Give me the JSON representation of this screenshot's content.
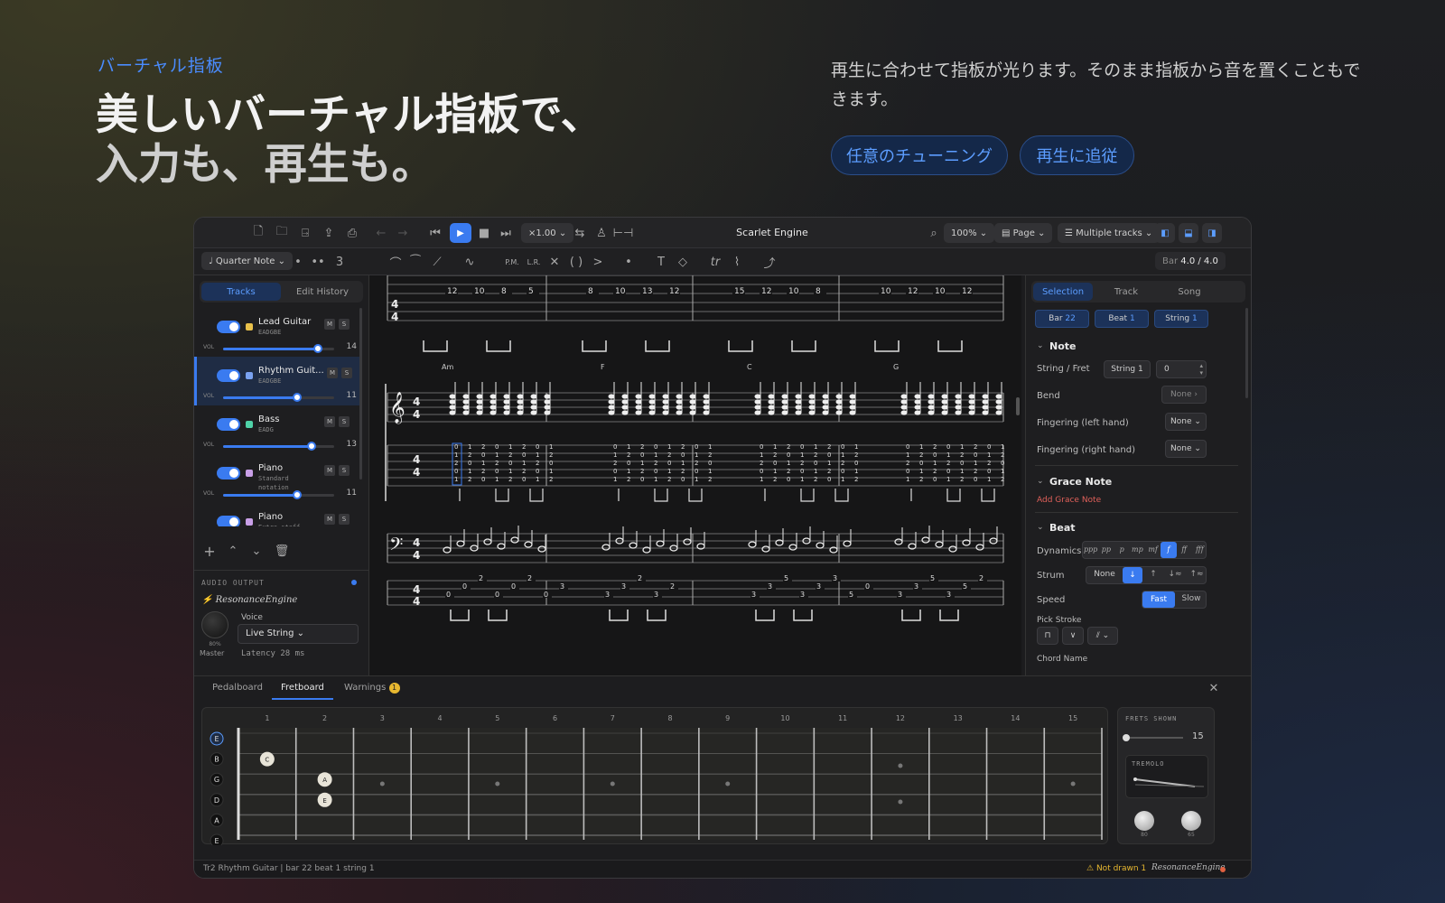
{
  "hero": {
    "eyebrow": "バーチャル指板",
    "title_line1": "美しいバーチャル指板で、",
    "title_line2": "入力も、再生も。",
    "description": "再生に合わせて指板が光ります。そのまま指板から音を置くこともできます。",
    "pill1": "任意のチューニング",
    "pill2": "再生に追従"
  },
  "toolbar": {
    "speed": "×1.00",
    "title": "Scarlet Engine",
    "zoom": "100%",
    "view": "Page",
    "tracks_mode": "Multiple tracks"
  },
  "toolbar2": {
    "note_value": "Quarter Note",
    "tuplet": "3",
    "pm": "P.M.",
    "lr": "L.R.",
    "bar_label": "Bar",
    "bar_value": "4.0 / 4.0"
  },
  "left": {
    "tab_tracks": "Tracks",
    "tab_history": "Edit History",
    "tracks": [
      {
        "name": "Lead Guitar",
        "sub": "EADGBE",
        "vol": 14,
        "level": 0.85,
        "color": "#e8c04a"
      },
      {
        "name": "Rhythm Guit...",
        "sub": "EADGBE",
        "vol": 11,
        "level": 0.67,
        "color": "#7aa2f0"
      },
      {
        "name": "Bass",
        "sub": "EADG",
        "vol": 13,
        "level": 0.8,
        "color": "#4fd2a8"
      },
      {
        "name": "Piano",
        "sub": "Standard notation",
        "vol": 11,
        "level": 0.67,
        "color": "#c9a0e8"
      },
      {
        "name": "Piano",
        "sub": "Extra staff",
        "vol": null,
        "level": null,
        "color": "#c9a0e8"
      }
    ],
    "m": "M",
    "s": "S",
    "vol_label": "VOL",
    "audio_output": "AUDIO OUTPUT",
    "engine": "ResonanceEngine",
    "voice_label": "Voice",
    "voice_value": "Live String",
    "latency": "Latency 28 ms",
    "master_label": "Master",
    "master_pct": "80%"
  },
  "score": {
    "chords": [
      "Am",
      "F",
      "C",
      "G"
    ],
    "tab_top": [
      [
        "12",
        "10",
        "8",
        "5"
      ],
      [
        "8",
        "10",
        "13",
        "12"
      ],
      [
        "15",
        "12",
        "10",
        "8"
      ],
      [
        "10",
        "12",
        "10",
        "12"
      ]
    ],
    "bass_tab": [
      [
        "0",
        "0",
        "2",
        "0",
        "0",
        "2",
        "0",
        "3"
      ],
      [
        "3",
        "3",
        "2",
        "3",
        "2"
      ],
      [
        "3",
        "3",
        "5",
        "3",
        "3",
        "3",
        "5",
        "0"
      ],
      [
        "3",
        "3",
        "5",
        "3",
        "5",
        "2"
      ]
    ]
  },
  "right": {
    "tabs": [
      "Selection",
      "Track",
      "Song"
    ],
    "bar": "Bar",
    "bar_v": "22",
    "beat": "Beat",
    "beat_v": "1",
    "string": "String",
    "string_v": "1",
    "note_head": "Note",
    "string_fret": "String / Fret",
    "sf_string": "String 1",
    "sf_fret": "0",
    "bend": "Bend",
    "bend_v": "None",
    "fing_l": "Fingering (left hand)",
    "fing_l_v": "None",
    "fing_r": "Fingering (right hand)",
    "fing_r_v": "None",
    "grace_head": "Grace Note",
    "add_grace": "Add Grace Note",
    "beat_head": "Beat",
    "dynamics": "Dynamics",
    "dyn_opts": [
      "ppp",
      "pp",
      "p",
      "mp",
      "mf",
      "f",
      "ff",
      "fff"
    ],
    "dyn_sel": "f",
    "strum": "Strum",
    "strum_none": "None",
    "strum_opts": [
      "↓",
      "↑",
      "↓≈",
      "↑≈"
    ],
    "speed": "Speed",
    "fast": "Fast",
    "slow": "Slow",
    "pick_stroke": "Pick Stroke",
    "chord_name": "Chord Name"
  },
  "bottom": {
    "tabs": [
      "Pedalboard",
      "Fretboard",
      "Warnings"
    ],
    "warn_count": "1",
    "frets": [
      "1",
      "2",
      "3",
      "4",
      "5",
      "6",
      "7",
      "8",
      "9",
      "10",
      "11",
      "12",
      "13",
      "14",
      "15"
    ],
    "strings": [
      "E",
      "B",
      "G",
      "D",
      "A",
      "E"
    ],
    "dots": [
      {
        "string": 1,
        "fret": 1,
        "label": "C"
      },
      {
        "string": 2,
        "fret": 2,
        "label": "A"
      },
      {
        "string": 3,
        "fret": 2,
        "label": "E"
      }
    ],
    "frets_shown": "FRETS SHOWN",
    "frets_shown_v": "15",
    "tremolo": "TREMOLO",
    "knob1": "80",
    "knob2": "65"
  },
  "status": {
    "left": "Tr2 Rhythm Guitar | bar 22 beat 1 string 1",
    "warn": "Not drawn 1",
    "engine": "ResonanceEngine"
  },
  "colors": {
    "accent": "#3a7bf0",
    "brand_blue": "#4a8cff"
  }
}
